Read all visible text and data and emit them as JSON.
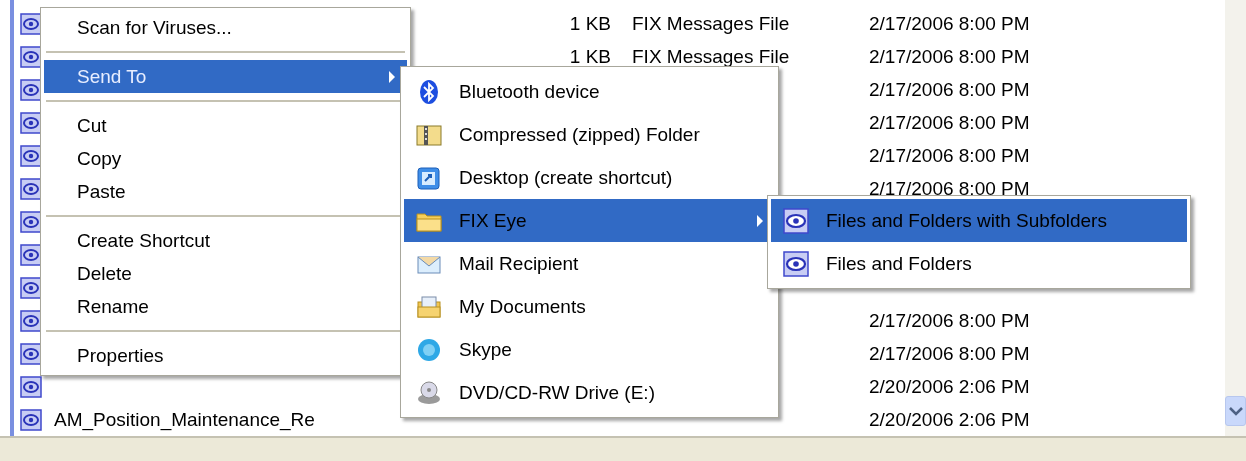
{
  "file_list": {
    "rows": [
      {
        "size": "1 KB",
        "type": "FIX Messages File",
        "modified": "2/17/2006 8:00 PM"
      },
      {
        "size": "1 KB",
        "type": "FIX Messages File",
        "modified": "2/17/2006 8:00 PM"
      },
      {
        "modified": "2/17/2006 8:00 PM"
      },
      {
        "modified": "2/17/2006 8:00 PM"
      },
      {
        "modified": "2/17/2006 8:00 PM"
      },
      {
        "modified": "2/17/2006 8:00 PM"
      },
      {},
      {},
      {},
      {
        "modified": "2/17/2006 8:00 PM"
      },
      {
        "modified": "2/17/2006 8:00 PM"
      },
      {
        "modified": "2/20/2006 2:06 PM"
      },
      {
        "name": "AM_Position_Maintenance_Re",
        "modified": "2/20/2006 2:06 PM"
      }
    ]
  },
  "context_menu": {
    "items": [
      {
        "kind": "item",
        "label": "Scan for Viruses...",
        "selected": false
      },
      {
        "kind": "separator"
      },
      {
        "kind": "item",
        "label": "Send To",
        "selected": true,
        "has_submenu": true
      },
      {
        "kind": "separator"
      },
      {
        "kind": "item",
        "label": "Cut",
        "selected": false
      },
      {
        "kind": "item",
        "label": "Copy",
        "selected": false
      },
      {
        "kind": "item",
        "label": "Paste",
        "selected": false
      },
      {
        "kind": "separator"
      },
      {
        "kind": "item",
        "label": "Create Shortcut",
        "selected": false
      },
      {
        "kind": "item",
        "label": "Delete",
        "selected": false
      },
      {
        "kind": "item",
        "label": "Rename",
        "selected": false
      },
      {
        "kind": "separator"
      },
      {
        "kind": "item",
        "label": "Properties",
        "selected": false
      }
    ]
  },
  "send_to_menu": {
    "items": [
      {
        "label": "Bluetooth device",
        "selected": false
      },
      {
        "label": "Compressed (zipped) Folder",
        "selected": false
      },
      {
        "label": "Desktop (create shortcut)",
        "selected": false
      },
      {
        "label": "FIX Eye",
        "selected": true,
        "has_submenu": true
      },
      {
        "label": "Mail Recipient",
        "selected": false
      },
      {
        "label": "My Documents",
        "selected": false
      },
      {
        "label": "Skype",
        "selected": false
      },
      {
        "label": "DVD/CD-RW Drive (E:)",
        "selected": false
      }
    ]
  },
  "fix_eye_menu": {
    "items": [
      {
        "label": "Files and Folders with Subfolders",
        "selected": true
      },
      {
        "label": "Files and Folders",
        "selected": false
      }
    ]
  }
}
